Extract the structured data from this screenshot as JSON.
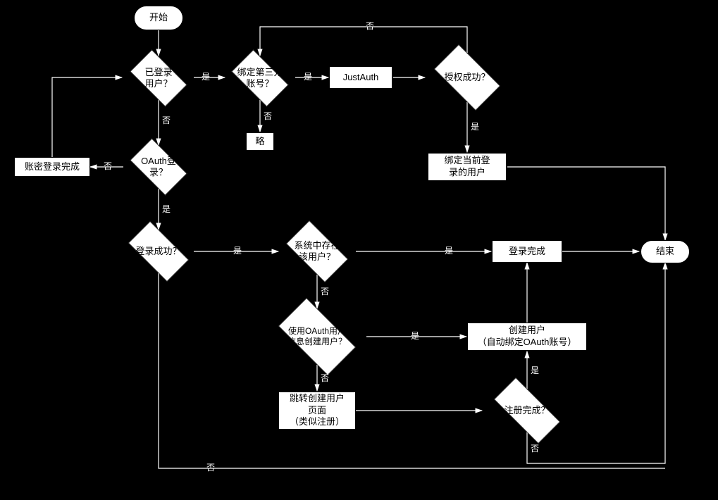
{
  "nodes": {
    "start": "开始",
    "loggedIn": "已登录\n用户？",
    "bindThirdAccount": "绑定第三方\n账号？",
    "justAuth": "JustAuth",
    "authOk": "授权成功？",
    "bindCurrentUser": "绑定当前登\n录的用户",
    "end": "结束",
    "oauthLogin": "OAuth登\n录？",
    "pwdLoginDone": "账密登录完成",
    "skip": "略",
    "loginOk": "登录成功？",
    "userInSystem": "系统中存在\n该用户？",
    "loginDone": "登录完成",
    "useOauthCreate": "使用OAuth用户\n信息创建用户？",
    "createUser": "创建用户\n（自动绑定OAuth账号）",
    "gotoCreatePage": "跳转创建用户\n页面\n（类似注册）",
    "registerDone": "注册完成？"
  },
  "edges": {
    "yes": "是",
    "no": "否"
  }
}
